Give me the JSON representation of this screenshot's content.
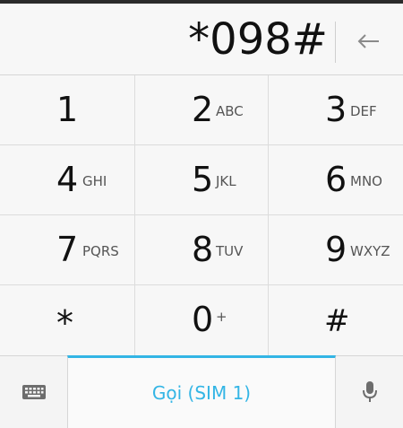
{
  "display": {
    "number": "*098#"
  },
  "keys": [
    {
      "digit": "1",
      "letters": ""
    },
    {
      "digit": "2",
      "letters": "ABC"
    },
    {
      "digit": "3",
      "letters": "DEF"
    },
    {
      "digit": "4",
      "letters": "GHI"
    },
    {
      "digit": "5",
      "letters": "JKL"
    },
    {
      "digit": "6",
      "letters": "MNO"
    },
    {
      "digit": "7",
      "letters": "PQRS"
    },
    {
      "digit": "8",
      "letters": "TUV"
    },
    {
      "digit": "9",
      "letters": "WXYZ"
    },
    {
      "digit": "*",
      "letters": ""
    },
    {
      "digit": "0",
      "letters": "+"
    },
    {
      "digit": "#",
      "letters": ""
    }
  ],
  "bottom_bar": {
    "call_label": "Gọi (SIM 1)"
  },
  "icons": {
    "backspace": "backspace-arrow-icon",
    "keyboard": "keyboard-icon",
    "microphone": "microphone-icon"
  },
  "colors": {
    "accent": "#33b5e5",
    "digit_text": "#111111",
    "letters_text": "#555555",
    "icon_gray": "#6d6d6d"
  }
}
